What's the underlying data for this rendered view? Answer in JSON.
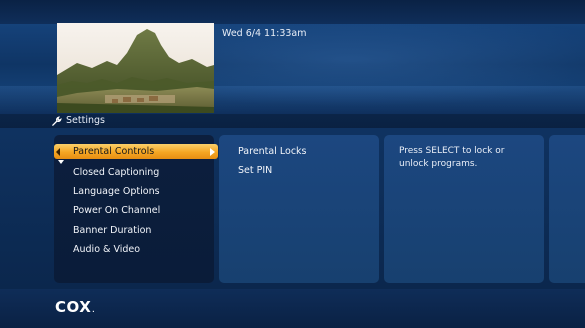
{
  "header": {
    "datetime": "Wed 6/4  11:33am"
  },
  "section": {
    "title": "Settings",
    "icon": "wrench-icon"
  },
  "menu": {
    "items": [
      {
        "label": "Parental Controls",
        "selected": true
      },
      {
        "label": "Closed Captioning"
      },
      {
        "label": "Language Options"
      },
      {
        "label": "Power On Channel"
      },
      {
        "label": "Banner Duration"
      },
      {
        "label": "Audio & Video"
      }
    ]
  },
  "submenu": {
    "items": [
      {
        "label": "Parental Locks"
      },
      {
        "label": "Set PIN"
      }
    ]
  },
  "help": {
    "text": "Press SELECT to lock or unlock programs."
  },
  "footer": {
    "logo": "COX",
    "logo_dot": "."
  },
  "colors": {
    "selection": "#f5a623",
    "background": "#0f3260",
    "panel": "#1c4780"
  }
}
